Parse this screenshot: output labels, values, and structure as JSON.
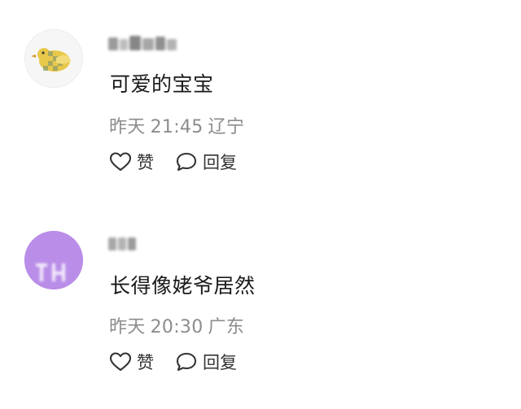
{
  "comments": [
    {
      "username": "",
      "avatar": "duck-avatar",
      "text": "可爱的宝宝",
      "date": "昨天",
      "time": "21:45",
      "location": "辽宁",
      "like_label": "赞",
      "reply_label": "回复"
    },
    {
      "username": "",
      "avatar": "purple-initial-avatar",
      "text": "长得像姥爷居然",
      "date": "昨天",
      "time": "20:30",
      "location": "广东",
      "like_label": "赞",
      "reply_label": "回复"
    }
  ],
  "colors": {
    "background": "#ffffff",
    "text": "#1a1a1a",
    "meta": "#8c8c8c",
    "avatar2": "#b98de8"
  }
}
